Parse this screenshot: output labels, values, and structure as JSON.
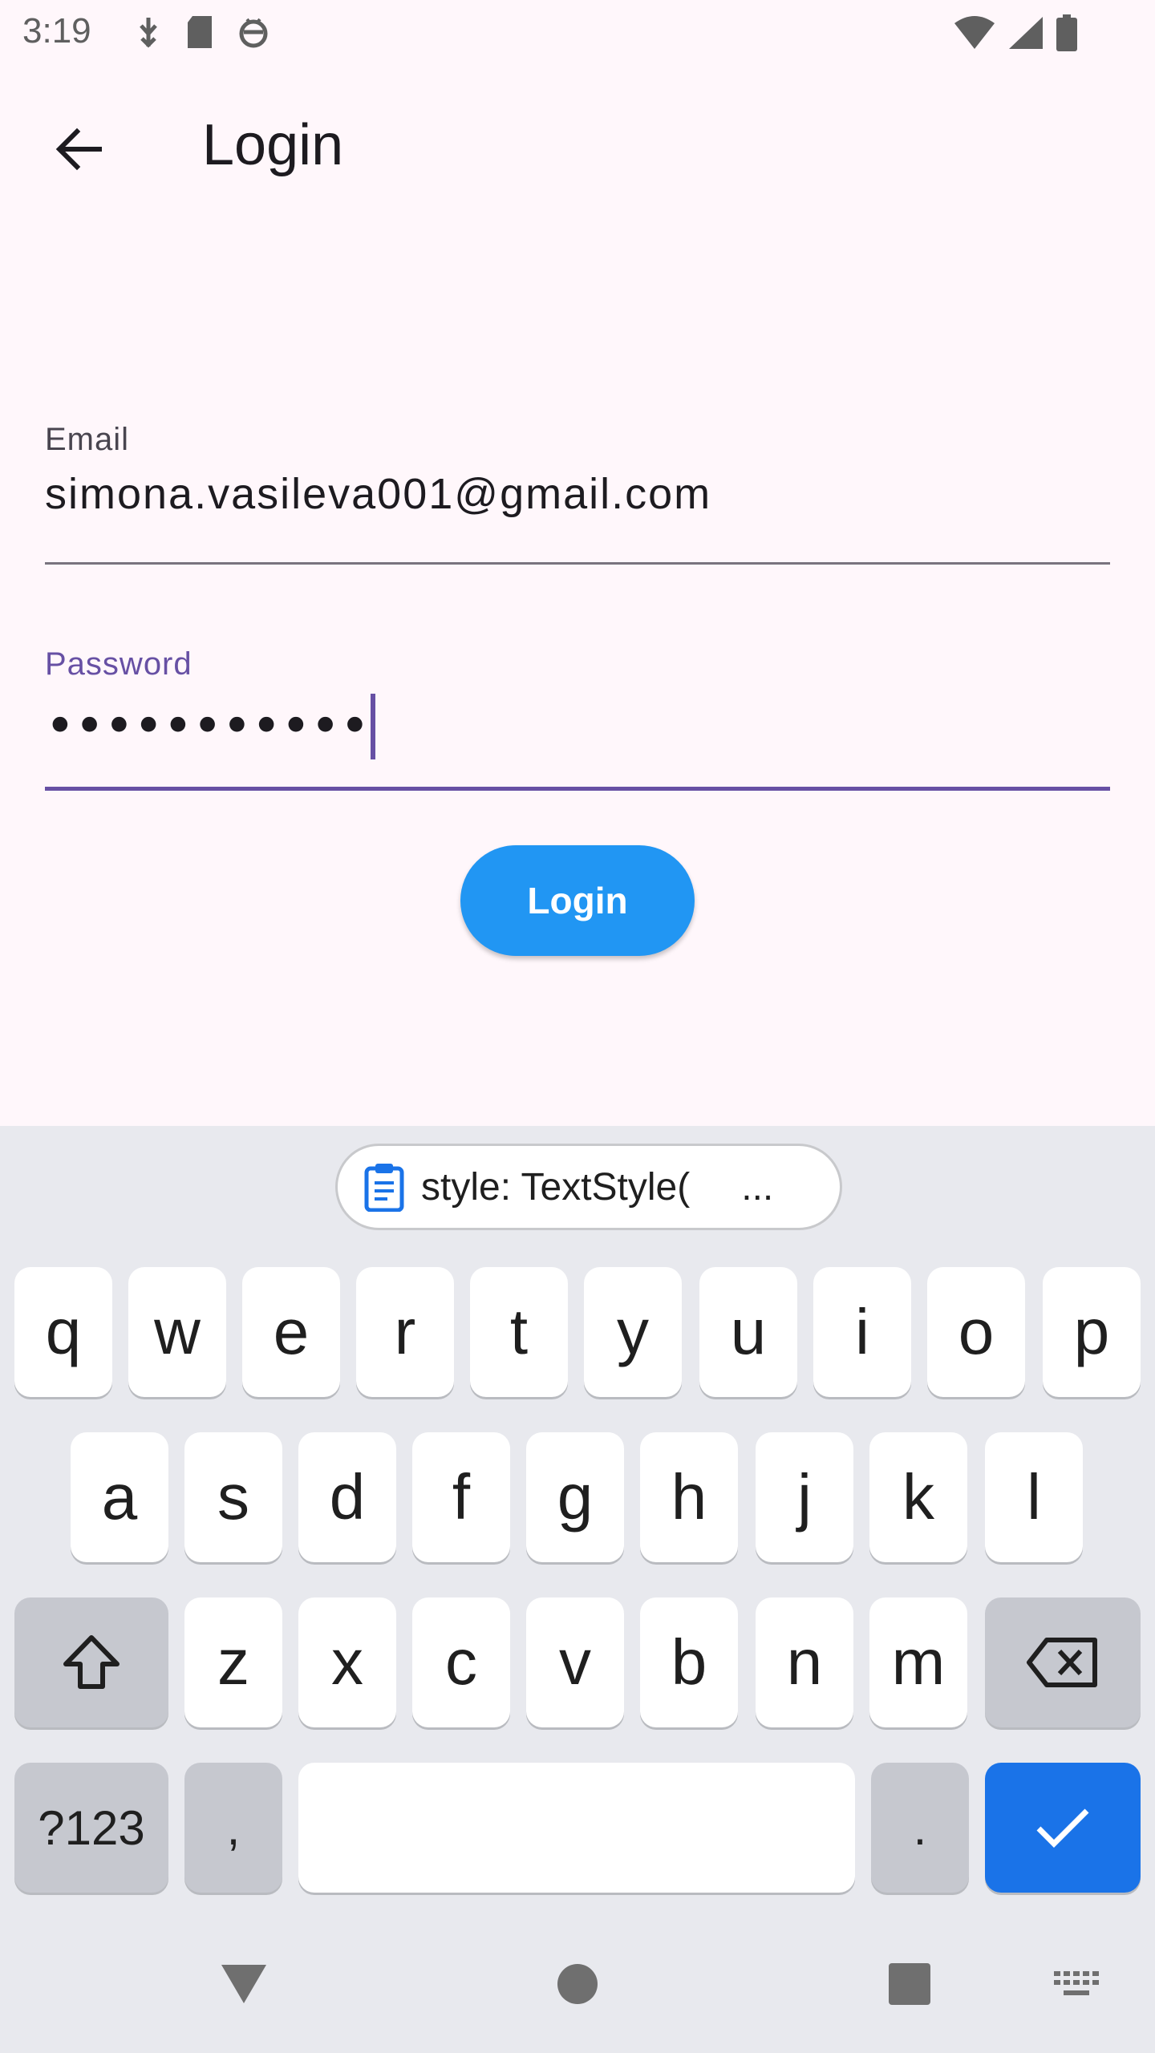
{
  "status_bar": {
    "time": "3:19"
  },
  "app_bar": {
    "title": "Login"
  },
  "form": {
    "email": {
      "label": "Email",
      "value": "simona.vasileva001@gmail.com"
    },
    "password": {
      "label": "Password",
      "masked_value": "•••••••••••"
    },
    "login_button": "Login"
  },
  "keyboard": {
    "clipboard_suggestion": "style: TextStyle(",
    "clipboard_more": "...",
    "row1": [
      "q",
      "w",
      "e",
      "r",
      "t",
      "y",
      "u",
      "i",
      "o",
      "p"
    ],
    "row2": [
      "a",
      "s",
      "d",
      "f",
      "g",
      "h",
      "j",
      "k",
      "l"
    ],
    "row3": [
      "z",
      "x",
      "c",
      "v",
      "b",
      "n",
      "m"
    ],
    "symbols_key": "?123",
    "comma_key": ",",
    "period_key": ".",
    "icons": {
      "shift": "shift-icon",
      "backspace": "backspace-icon",
      "done": "check-icon",
      "clipboard": "clipboard-icon"
    }
  },
  "colors": {
    "accent": "#6750a4",
    "login_button": "#2196f3",
    "done_key": "#1a73e8",
    "background": "#fff7fb",
    "keyboard_bg": "#e8e9ee"
  }
}
